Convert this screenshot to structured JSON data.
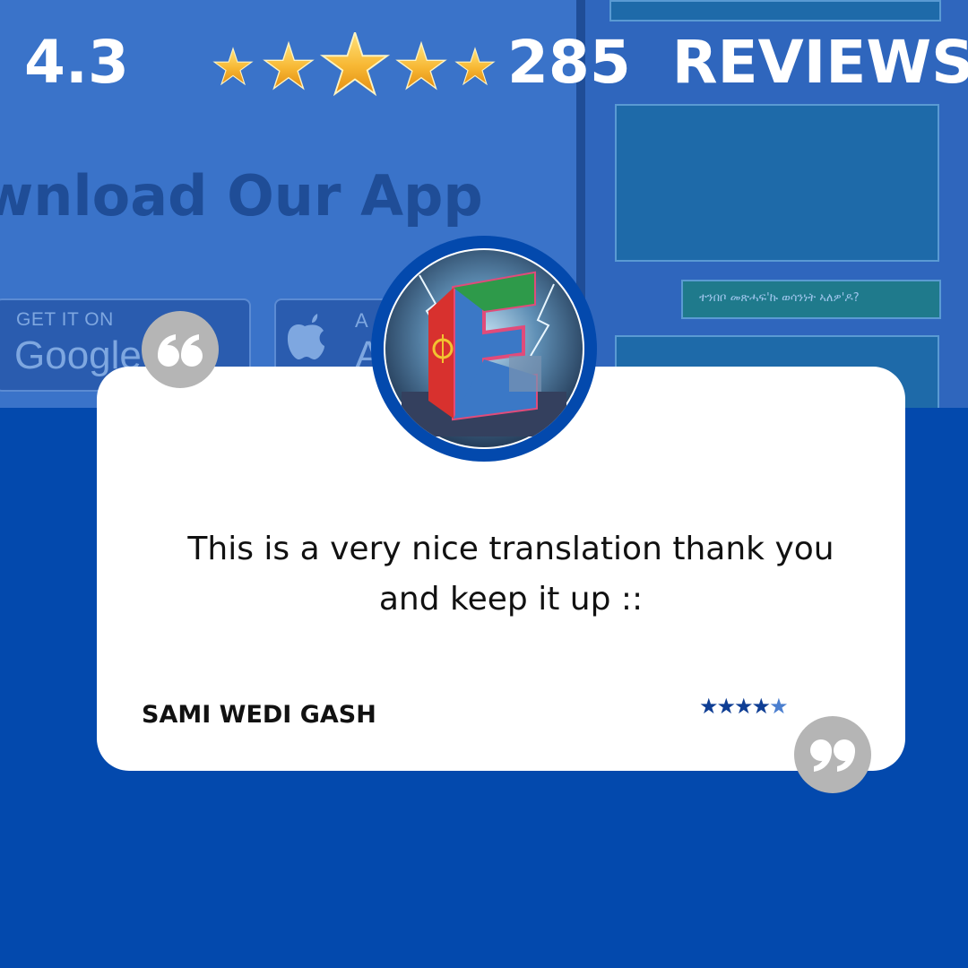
{
  "header": {
    "rating": "4.3",
    "review_count": "285  REVIEWS",
    "stars": 5
  },
  "background": {
    "download_heading": "wnload Our App",
    "google_badge_top": "GET IT ON",
    "google_badge_main": "Google",
    "apple_badge_top": "A",
    "apple_badge_main": "A",
    "chat_reply": "ተንበቦ መጽሓፍ'ኩ ወሳንነት ኣለዎ'ዶ?"
  },
  "review": {
    "text": "This is a very nice translation thank you and keep it up ::",
    "reviewer": "SAMI WEDI GASH",
    "rating_stars": "★★★★",
    "rating_half_star": "★"
  },
  "colors": {
    "brand_blue": "#0349ad",
    "card_bg": "#ffffff",
    "quote_gray": "#b5b5b5",
    "star_gold": "#f7b733"
  },
  "icons": {
    "quote": "quote-icon",
    "stars": "star-icon",
    "avatar": "app-logo-avatar"
  }
}
